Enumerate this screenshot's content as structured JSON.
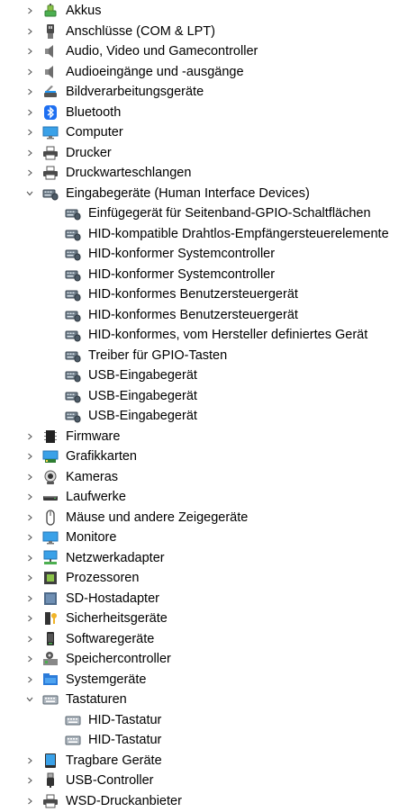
{
  "tree": [
    {
      "label": "Akkus",
      "icon": "battery-icon",
      "level": 0,
      "expander": "collapsed"
    },
    {
      "label": "Anschlüsse (COM & LPT)",
      "icon": "port-icon",
      "level": 0,
      "expander": "collapsed"
    },
    {
      "label": "Audio, Video und Gamecontroller",
      "icon": "speaker-icon",
      "level": 0,
      "expander": "collapsed"
    },
    {
      "label": "Audioeingänge und -ausgänge",
      "icon": "speaker-icon",
      "level": 0,
      "expander": "collapsed"
    },
    {
      "label": "Bildverarbeitungsgeräte",
      "icon": "scanner-icon",
      "level": 0,
      "expander": "collapsed"
    },
    {
      "label": "Bluetooth",
      "icon": "bluetooth-icon",
      "level": 0,
      "expander": "collapsed"
    },
    {
      "label": "Computer",
      "icon": "monitor-icon",
      "level": 0,
      "expander": "collapsed"
    },
    {
      "label": "Drucker",
      "icon": "printer-icon",
      "level": 0,
      "expander": "collapsed"
    },
    {
      "label": "Druckwarteschlangen",
      "icon": "printer-icon",
      "level": 0,
      "expander": "collapsed"
    },
    {
      "label": "Eingabegeräte (Human Interface Devices)",
      "icon": "hid-icon",
      "level": 0,
      "expander": "expanded"
    },
    {
      "label": "Einfügegerät für Seitenband-GPIO-Schaltflächen",
      "icon": "hid-icon",
      "level": 1
    },
    {
      "label": "HID-kompatible Drahtlos-Empfängersteuerelemente",
      "icon": "hid-icon",
      "level": 1
    },
    {
      "label": "HID-konformer Systemcontroller",
      "icon": "hid-icon",
      "level": 1
    },
    {
      "label": "HID-konformer Systemcontroller",
      "icon": "hid-icon",
      "level": 1
    },
    {
      "label": "HID-konformes Benutzersteuergerät",
      "icon": "hid-icon",
      "level": 1
    },
    {
      "label": "HID-konformes Benutzersteuergerät",
      "icon": "hid-icon",
      "level": 1
    },
    {
      "label": "HID-konformes, vom Hersteller definiertes Gerät",
      "icon": "hid-icon",
      "level": 1
    },
    {
      "label": "Treiber für GPIO-Tasten",
      "icon": "hid-icon",
      "level": 1
    },
    {
      "label": "USB-Eingabegerät",
      "icon": "hid-icon",
      "level": 1
    },
    {
      "label": "USB-Eingabegerät",
      "icon": "hid-icon",
      "level": 1
    },
    {
      "label": "USB-Eingabegerät",
      "icon": "hid-icon",
      "level": 1
    },
    {
      "label": "Firmware",
      "icon": "chip-icon",
      "level": 0,
      "expander": "collapsed"
    },
    {
      "label": "Grafikkarten",
      "icon": "display-adapter-icon",
      "level": 0,
      "expander": "collapsed"
    },
    {
      "label": "Kameras",
      "icon": "camera-icon",
      "level": 0,
      "expander": "collapsed"
    },
    {
      "label": "Laufwerke",
      "icon": "drive-icon",
      "level": 0,
      "expander": "collapsed"
    },
    {
      "label": "Mäuse und andere Zeigegeräte",
      "icon": "mouse-icon",
      "level": 0,
      "expander": "collapsed"
    },
    {
      "label": "Monitore",
      "icon": "monitor-icon",
      "level": 0,
      "expander": "collapsed"
    },
    {
      "label": "Netzwerkadapter",
      "icon": "network-icon",
      "level": 0,
      "expander": "collapsed"
    },
    {
      "label": "Prozessoren",
      "icon": "processor-icon",
      "level": 0,
      "expander": "collapsed"
    },
    {
      "label": "SD-Hostadapter",
      "icon": "sd-card-icon",
      "level": 0,
      "expander": "collapsed"
    },
    {
      "label": "Sicherheitsgeräte",
      "icon": "security-key-icon",
      "level": 0,
      "expander": "collapsed"
    },
    {
      "label": "Softwaregeräte",
      "icon": "software-device-icon",
      "level": 0,
      "expander": "collapsed"
    },
    {
      "label": "Speichercontroller",
      "icon": "storage-controller-icon",
      "level": 0,
      "expander": "collapsed"
    },
    {
      "label": "Systemgeräte",
      "icon": "system-folder-icon",
      "level": 0,
      "expander": "collapsed"
    },
    {
      "label": "Tastaturen",
      "icon": "keyboard-icon",
      "level": 0,
      "expander": "expanded"
    },
    {
      "label": "HID-Tastatur",
      "icon": "keyboard-icon",
      "level": 1
    },
    {
      "label": "HID-Tastatur",
      "icon": "keyboard-icon",
      "level": 1
    },
    {
      "label": "Tragbare Geräte",
      "icon": "portable-device-icon",
      "level": 0,
      "expander": "collapsed"
    },
    {
      "label": "USB-Controller",
      "icon": "usb-icon",
      "level": 0,
      "expander": "collapsed"
    },
    {
      "label": "WSD-Druckanbieter",
      "icon": "printer-icon",
      "level": 0,
      "expander": "collapsed"
    }
  ]
}
